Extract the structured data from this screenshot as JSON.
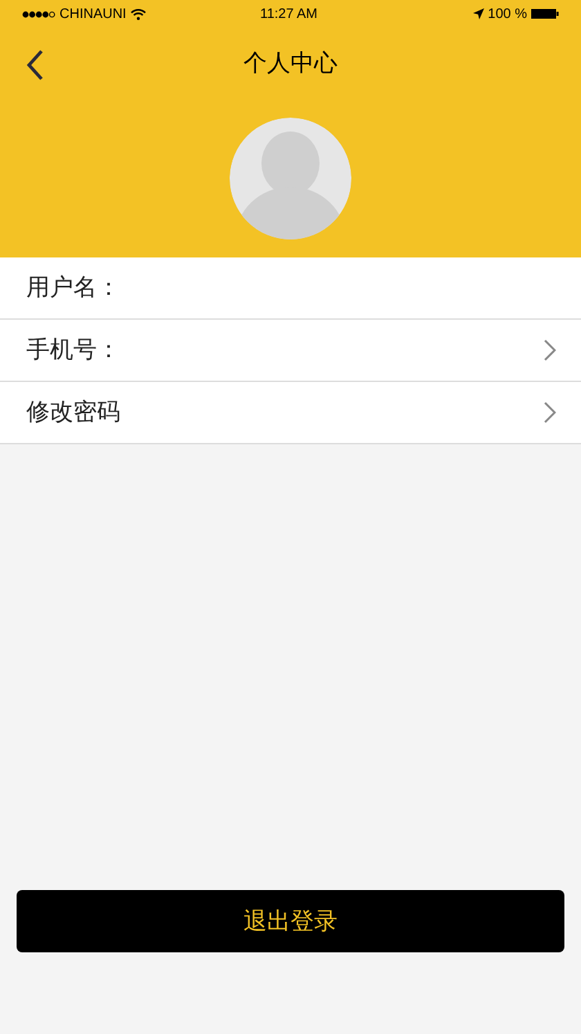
{
  "status_bar": {
    "carrier": "CHINAUNI",
    "time": "11:27 AM",
    "battery": "100 %"
  },
  "nav": {
    "title": "个人中心"
  },
  "rows": [
    {
      "label": "用户名：",
      "chevron": false
    },
    {
      "label": "手机号：",
      "chevron": true
    },
    {
      "label": "修改密码",
      "chevron": true
    }
  ],
  "logout_button": "退出登录"
}
